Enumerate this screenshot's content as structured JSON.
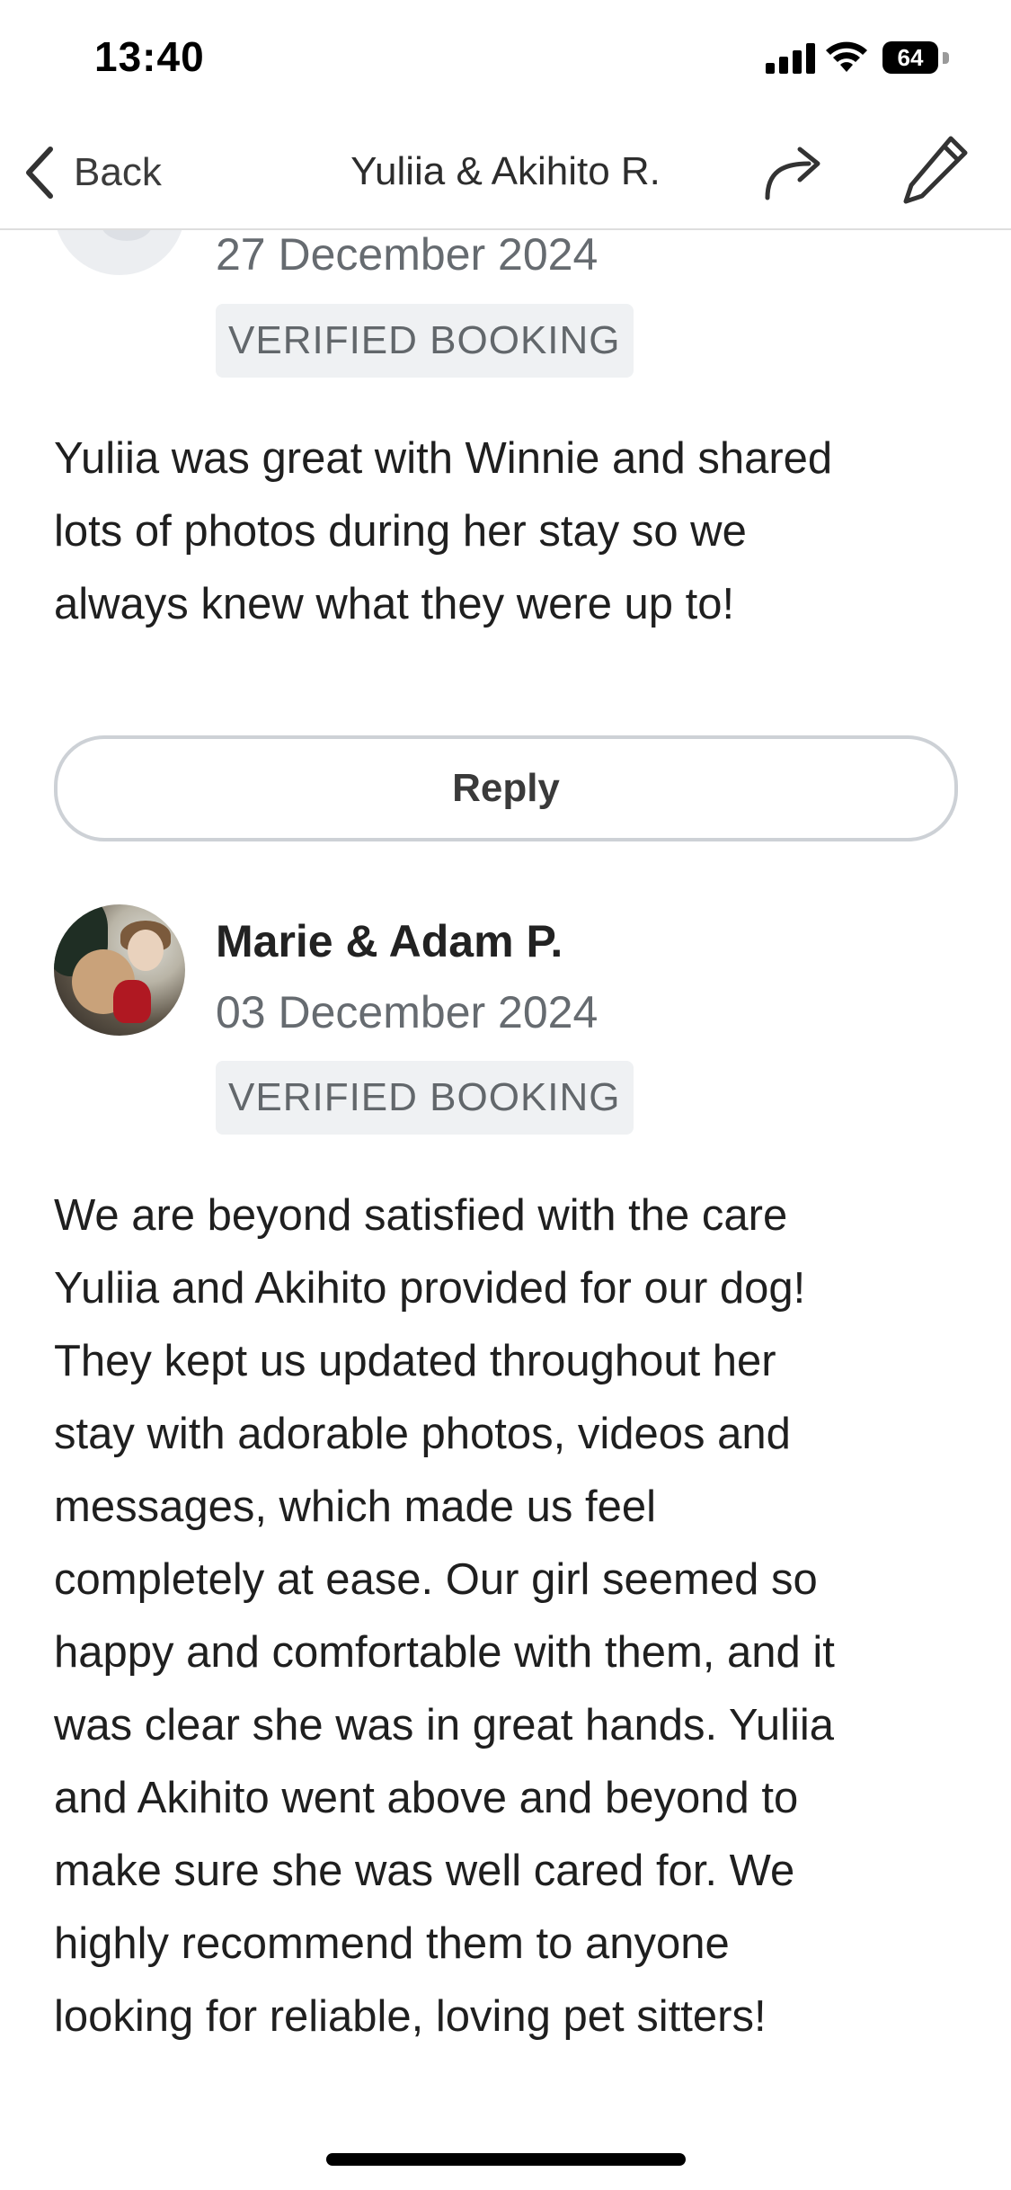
{
  "status_bar": {
    "time": "13:40",
    "battery_level": "64",
    "icons": [
      "signal-icon",
      "wifi-icon",
      "battery-icon"
    ]
  },
  "nav": {
    "back_label": "Back",
    "title": "Yuliia & Akihito R.",
    "icons": [
      "chevron-left-icon",
      "share-icon",
      "edit-pencil-icon"
    ]
  },
  "reviews": [
    {
      "date": "27 December 2024",
      "badge": "VERIFIED BOOKING",
      "text_lines": [
        "Yuliia was great with Winnie and shared",
        "lots of photos during her stay so we",
        "always knew what they were up to!"
      ],
      "reply_label": "Reply"
    },
    {
      "name": "Marie & Adam P.",
      "date": "03 December 2024",
      "badge": "VERIFIED BOOKING",
      "text_lines": [
        "We are beyond satisfied with the care",
        "Yuliia and Akihito provided for our dog!",
        "They kept us updated throughout her",
        "stay with adorable photos, videos and",
        "messages, which made us feel",
        "completely at ease. Our girl seemed so",
        "happy and comfortable with them, and it",
        "was clear she was in great hands. Yuliia",
        "and Akihito went above and beyond to",
        "make sure she was well cared for. We",
        "highly recommend them to anyone",
        "looking for reliable, loving pet sitters!"
      ]
    }
  ]
}
